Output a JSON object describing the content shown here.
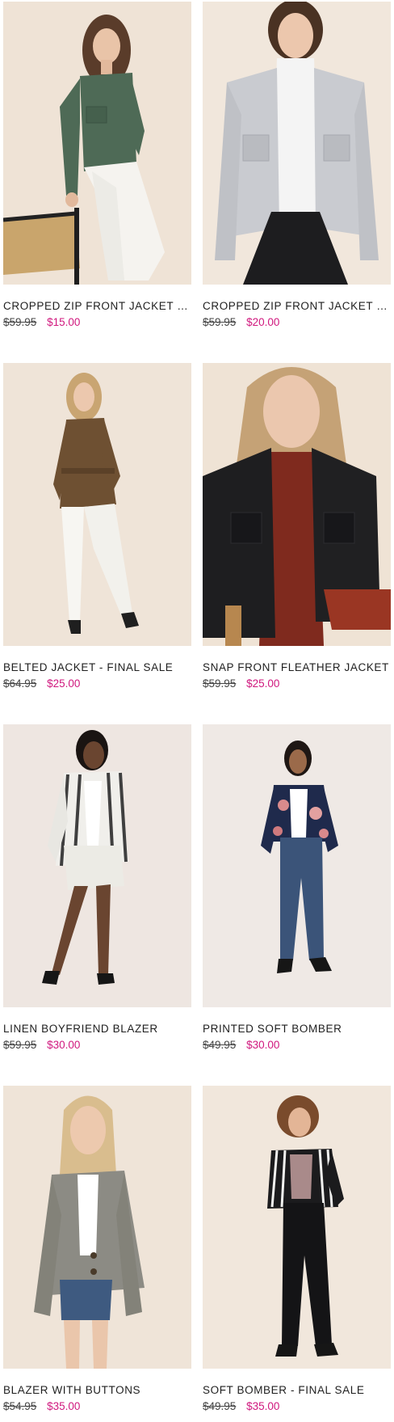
{
  "products": [
    {
      "name": "CROPPED ZIP FRONT JACKET - FINAL SALE",
      "original_price": "$59.95",
      "sale_price": "$15.00",
      "image": "model-green-jacket"
    },
    {
      "name": "CROPPED ZIP FRONT JACKET - FINAL SALE",
      "original_price": "$59.95",
      "sale_price": "$20.00",
      "image": "model-grey-jacket"
    },
    {
      "name": "BELTED JACKET - FINAL SALE",
      "original_price": "$64.95",
      "sale_price": "$25.00",
      "image": "model-brown-belted-jacket"
    },
    {
      "name": "SNAP FRONT FLEATHER JACKET",
      "original_price": "$59.95",
      "sale_price": "$25.00",
      "image": "model-black-leather-jacket"
    },
    {
      "name": "LINEN BOYFRIEND BLAZER",
      "original_price": "$59.95",
      "sale_price": "$30.00",
      "image": "model-striped-blazer"
    },
    {
      "name": "PRINTED SOFT BOMBER",
      "original_price": "$49.95",
      "sale_price": "$30.00",
      "image": "model-floral-bomber"
    },
    {
      "name": "BLAZER WITH BUTTONS",
      "original_price": "$54.95",
      "sale_price": "$35.00",
      "image": "model-grey-blazer"
    },
    {
      "name": "SOFT BOMBER - FINAL SALE",
      "original_price": "$49.95",
      "sale_price": "$35.00",
      "image": "model-striped-bomber"
    }
  ],
  "colors": {
    "sale_price": "#d0187e",
    "original_price": "#444444",
    "product_name": "#1f1f1f"
  }
}
